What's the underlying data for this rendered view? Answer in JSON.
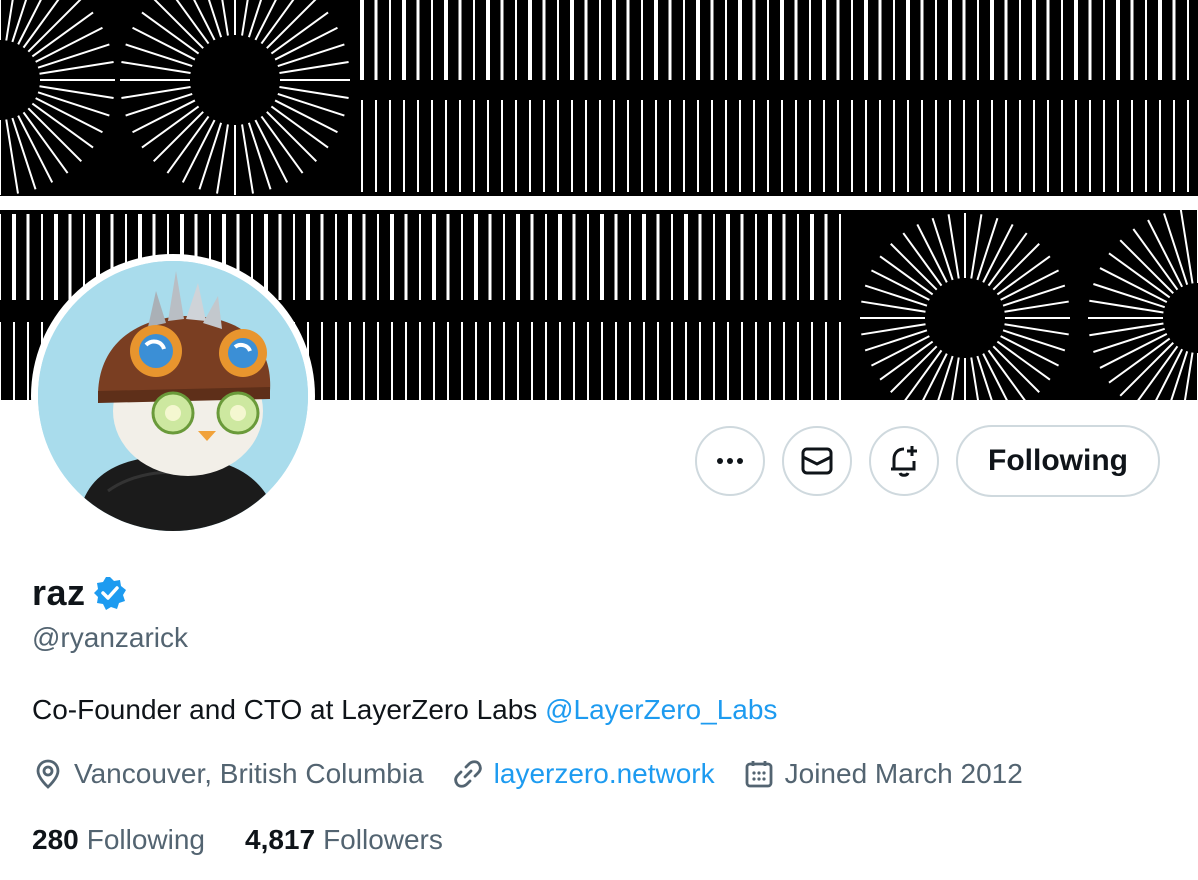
{
  "profile": {
    "name": "raz",
    "handle": "@ryanzarick",
    "bio_text": "Co-Founder and CTO at LayerZero Labs",
    "bio_mention": "@LayerZero_Labs",
    "location": "Vancouver, British Columbia",
    "website": "layerzero.network",
    "joined": "Joined March 2012",
    "following_count": "280",
    "following_label": "Following",
    "followers_count": "4,817",
    "followers_label": "Followers"
  },
  "actions": {
    "more_icon": "more-icon",
    "message_icon": "mail-icon",
    "notify_icon": "bell-plus-icon",
    "follow_label": "Following"
  },
  "colors": {
    "accent": "#1d9bf0",
    "secondary_text": "#536471",
    "border": "#cfd9de",
    "verified": "#1d9bf0"
  }
}
